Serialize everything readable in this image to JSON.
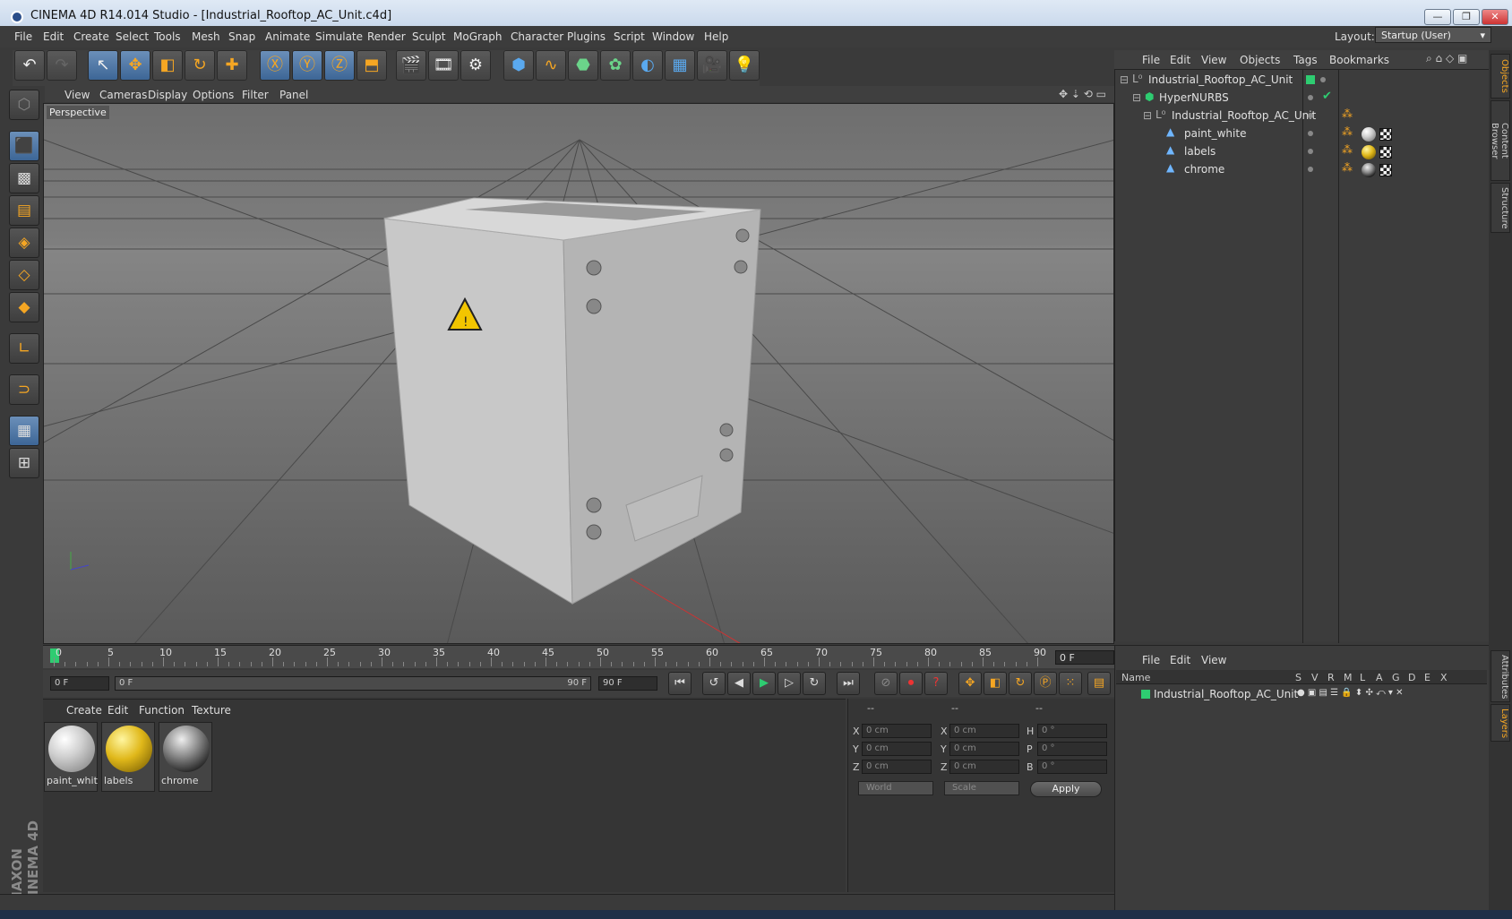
{
  "window": {
    "title": "CINEMA 4D R14.014 Studio - [Industrial_Rooftop_AC_Unit.c4d]",
    "min": "—",
    "max": "❐",
    "close": "✕"
  },
  "menubar": [
    "File",
    "Edit",
    "Create",
    "Select",
    "Tools",
    "Mesh",
    "Snap",
    "Animate",
    "Simulate",
    "Render",
    "Sculpt",
    "MoGraph",
    "Character",
    "Plugins",
    "Script",
    "Window",
    "Help"
  ],
  "layout": {
    "label": "Layout:",
    "value": "Startup (User)"
  },
  "viewport": {
    "menus": [
      "View",
      "Cameras",
      "Display",
      "Options",
      "Filter",
      "Panel"
    ],
    "label": "Perspective"
  },
  "timeline": {
    "ticks": [
      "0",
      "5",
      "10",
      "15",
      "20",
      "25",
      "30",
      "35",
      "40",
      "45",
      "50",
      "55",
      "60",
      "65",
      "70",
      "75",
      "80",
      "85",
      "90"
    ],
    "current_frame": "0 F",
    "start": "0 F",
    "range_start": "0 F",
    "range_end": "90 F",
    "end": "90 F"
  },
  "materials": {
    "menus": [
      "Create",
      "Edit",
      "Function",
      "Texture"
    ],
    "items": [
      {
        "name": "paint_whit",
        "color": "#cfcfcf"
      },
      {
        "name": "labels",
        "color": "#e0b81a"
      },
      {
        "name": "chrome",
        "color": "#8a8a8a"
      }
    ]
  },
  "coords": {
    "headers": [
      "--",
      "--",
      "--"
    ],
    "rows": [
      {
        "a": "X",
        "av": "0 cm",
        "b": "X",
        "bv": "0 cm",
        "c": "H",
        "cv": "0 °"
      },
      {
        "a": "Y",
        "av": "0 cm",
        "b": "Y",
        "bv": "0 cm",
        "c": "P",
        "cv": "0 °"
      },
      {
        "a": "Z",
        "av": "0 cm",
        "b": "Z",
        "bv": "0 cm",
        "c": "B",
        "cv": "0 °"
      }
    ],
    "world": "World",
    "scale": "Scale",
    "apply": "Apply"
  },
  "objects": {
    "menus": [
      "File",
      "Edit",
      "View",
      "Objects",
      "Tags",
      "Bookmarks"
    ],
    "tree": [
      {
        "name": "Industrial_Rooftop_AC_Unit",
        "icon_color": "#b0b0b0"
      },
      {
        "name": "HyperNURBS",
        "icon_color": "#2ecc71"
      },
      {
        "name": "Industrial_Rooftop_AC_Unit",
        "icon_color": "#b0b0b0"
      },
      {
        "name": "paint_white",
        "icon_color": "#6fb6ff"
      },
      {
        "name": "labels",
        "icon_color": "#6fb6ff"
      },
      {
        "name": "chrome",
        "icon_color": "#6fb6ff"
      }
    ]
  },
  "layers": {
    "menus": [
      "File",
      "Edit",
      "View"
    ],
    "columns": [
      "Name",
      "S",
      "V",
      "R",
      "M",
      "L",
      "A",
      "G",
      "D",
      "E",
      "X"
    ],
    "items": [
      {
        "name": "Industrial_Rooftop_AC_Unit",
        "color": "#2ecc71"
      }
    ]
  },
  "right_tabs": [
    "Objects",
    "Content Browser",
    "Structure",
    "Attributes",
    "Layers"
  ],
  "brand": "MAXON CINEMA 4D",
  "colors": {
    "accent": "#f5a623",
    "selection": "#3d6696",
    "green": "#2ecc71"
  }
}
